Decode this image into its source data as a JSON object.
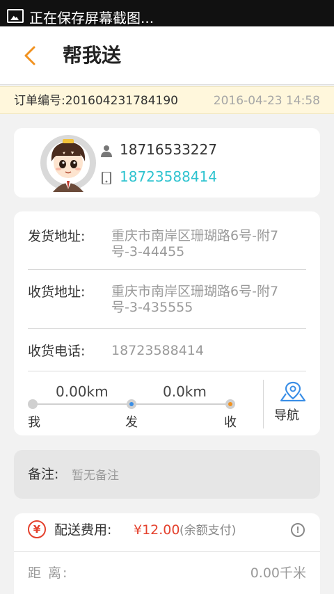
{
  "status_bar": {
    "notification": "正在保存屏幕截图..."
  },
  "header": {
    "title": "帮我送"
  },
  "order": {
    "number_label": "订单编号:201604231784190",
    "datetime": "2016-04-23 14:58"
  },
  "contact": {
    "phone_primary": "18716533227",
    "phone_secondary": "18723588414"
  },
  "addresses": {
    "sender_label": "发货地址:",
    "sender_value": "重庆市南岸区珊瑚路6号-附7号-3-44455",
    "receiver_label": "收货地址:",
    "receiver_value": "重庆市南岸区珊瑚路6号-附7号-3-435555",
    "receiver_phone_label": "收货电话:",
    "receiver_phone_value": "18723588414"
  },
  "route": {
    "distance_1": "0.00km",
    "distance_2": "0.0km",
    "point_me": "我",
    "point_send": "发",
    "point_receive": "收",
    "navigate_label": "导航"
  },
  "note": {
    "label": "备注:",
    "value": "暂无备注"
  },
  "fee": {
    "currency_icon": "¥",
    "label": "配送费用:",
    "amount": "¥12.00",
    "payment_note": "(余额支付)",
    "info_icon": "!",
    "distance_label": "距 离:",
    "distance_value": "0.00千米"
  },
  "colors": {
    "accent_orange": "#f19220",
    "phone_cyan": "#2ec3cf",
    "price_red": "#e4412d",
    "nav_blue": "#3a8ee6"
  }
}
